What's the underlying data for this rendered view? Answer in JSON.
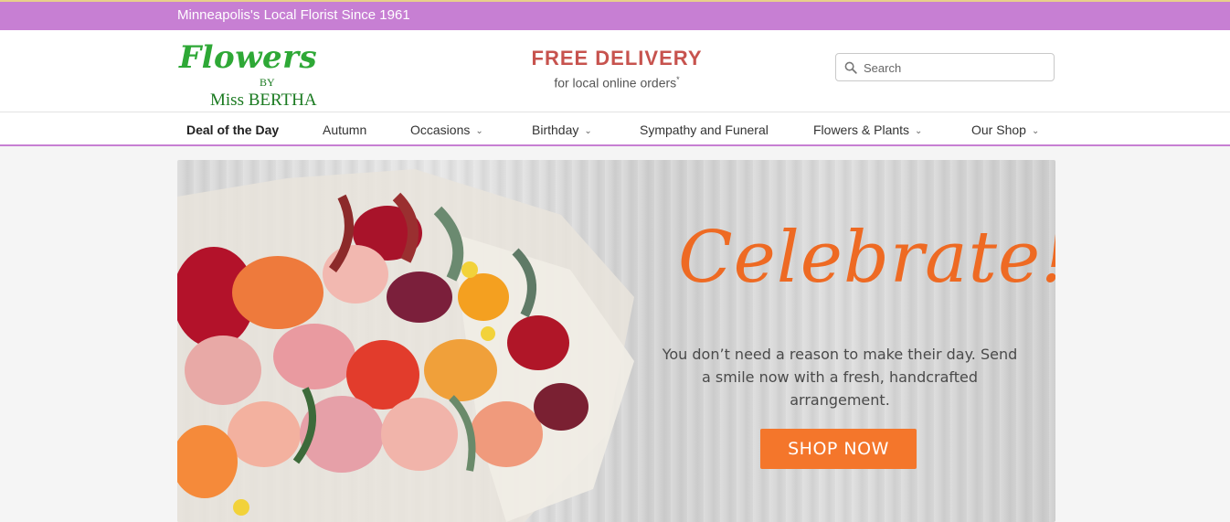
{
  "topbar": {
    "tagline": "Minneapolis's Local Florist Since 1961"
  },
  "logo": {
    "line1": "Flowers",
    "by": "BY",
    "name": "Miss BERTHA"
  },
  "promo": {
    "headline": "FREE DELIVERY",
    "subline": "for local online orders",
    "asterisk": "*"
  },
  "search": {
    "placeholder": "Search",
    "icon": "search-icon"
  },
  "nav": {
    "items": [
      {
        "label": "Deal of the Day",
        "dropdown": false
      },
      {
        "label": "Autumn",
        "dropdown": false
      },
      {
        "label": "Occasions",
        "dropdown": true
      },
      {
        "label": "Birthday",
        "dropdown": true
      },
      {
        "label": "Sympathy and Funeral",
        "dropdown": false
      },
      {
        "label": "Flowers & Plants",
        "dropdown": true
      },
      {
        "label": "Our Shop",
        "dropdown": true
      }
    ],
    "chevron": "⌄"
  },
  "hero": {
    "headline": "Celebrate!",
    "body_line1": "You don’t need a reason to make their day. Send",
    "body_line2": "a smile now with a fresh, handcrafted arrangement.",
    "cta": "SHOP NOW"
  },
  "colors": {
    "accent_purple": "#c77fd3",
    "brand_green": "#2ea836",
    "promo_red": "#c7534e",
    "cta_orange": "#f4762b"
  }
}
